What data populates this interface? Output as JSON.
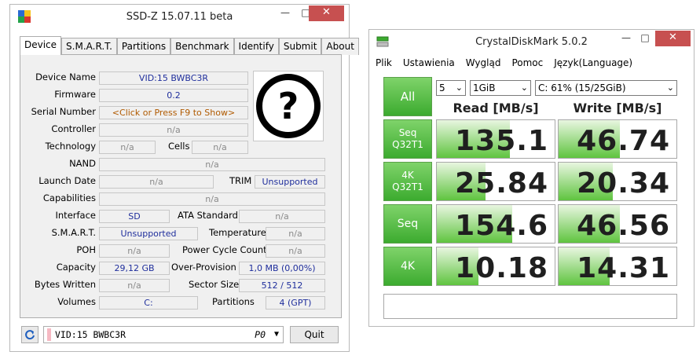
{
  "ssdz": {
    "title": "SSD-Z 15.07.11 beta",
    "controls": {
      "minimize": "—",
      "maximize": "□",
      "close": "✕"
    },
    "tabs": [
      "Device",
      "S.M.A.R.T.",
      "Partitions",
      "Benchmark",
      "Identify",
      "Submit",
      "About"
    ],
    "fields": {
      "device_name": {
        "label": "Device Name",
        "value": "VID:15 BWBC3R"
      },
      "firmware": {
        "label": "Firmware",
        "value": "0.2"
      },
      "serial_number": {
        "label": "Serial Number",
        "value": "<Click or Press F9 to Show>"
      },
      "controller": {
        "label": "Controller",
        "value": "n/a"
      },
      "technology": {
        "label": "Technology",
        "value": "n/a"
      },
      "cells": {
        "label": "Cells",
        "value": "n/a"
      },
      "nand": {
        "label": "NAND",
        "value": "n/a"
      },
      "launch_date": {
        "label": "Launch Date",
        "value": "n/a"
      },
      "trim": {
        "label": "TRIM",
        "value": "Unsupported"
      },
      "capabilities": {
        "label": "Capabilities",
        "value": "n/a"
      },
      "interface": {
        "label": "Interface",
        "value": "SD"
      },
      "ata_standard": {
        "label": "ATA Standard",
        "value": "n/a"
      },
      "smart": {
        "label": "S.M.A.R.T.",
        "value": "Unsupported"
      },
      "temperature": {
        "label": "Temperature",
        "value": "n/a"
      },
      "poh": {
        "label": "POH",
        "value": "n/a"
      },
      "power_cycle_count": {
        "label": "Power Cycle Count",
        "value": "n/a"
      },
      "capacity": {
        "label": "Capacity",
        "value": "29,12 GB"
      },
      "over_provision": {
        "label": "Over-Provision",
        "value": "1,0 MB (0,00%)"
      },
      "bytes_written": {
        "label": "Bytes Written",
        "value": "n/a"
      },
      "sector_size": {
        "label": "Sector Size",
        "value": "512 / 512"
      },
      "volumes": {
        "label": "Volumes",
        "value": "C:"
      },
      "partitions": {
        "label": "Partitions",
        "value": "4 (GPT)"
      }
    },
    "bottom": {
      "device_selector": "VID:15 BWBC3R",
      "port": "P0",
      "quit_label": "Quit"
    }
  },
  "cdm": {
    "title": "CrystalDiskMark 5.0.2",
    "controls": {
      "minimize": "—",
      "maximize": "□",
      "close": "✕"
    },
    "menu": [
      "Plik",
      "Ustawienia",
      "Wygląd",
      "Pomoc",
      "Język(Language)"
    ],
    "all_label": "All",
    "count": "5",
    "size": "1GiB",
    "drive": "C: 61% (15/25GiB)",
    "read_header": "Read [MB/s]",
    "write_header": "Write [MB/s]",
    "rows": [
      {
        "line1": "Seq",
        "line2": "Q32T1",
        "read": "135.1",
        "write": "46.74"
      },
      {
        "line1": "4K",
        "line2": "Q32T1",
        "read": "25.84",
        "write": "20.34"
      },
      {
        "line1": "Seq",
        "line2": "",
        "read": "154.6",
        "write": "46.56"
      },
      {
        "line1": "4K",
        "line2": "",
        "read": "10.18",
        "write": "14.31"
      }
    ],
    "fill_fractions_read": [
      0.62,
      0.41,
      0.64,
      0.35
    ],
    "fill_fractions_write": [
      0.52,
      0.46,
      0.52,
      0.43
    ],
    "accent_green": "#3cab2f"
  }
}
